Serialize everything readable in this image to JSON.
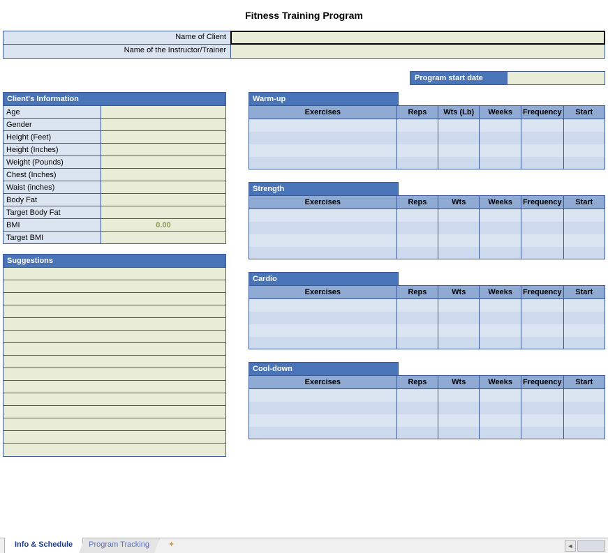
{
  "title": "Fitness Training Program",
  "header": {
    "client_label": "Name of Client",
    "trainer_label": "Name of the Instructor/Trainer",
    "client_value": "",
    "trainer_value": ""
  },
  "start_date": {
    "label": "Program start date",
    "value": ""
  },
  "client_info": {
    "header": "Client's Information",
    "rows": [
      {
        "label": "Age",
        "value": ""
      },
      {
        "label": "Gender",
        "value": ""
      },
      {
        "label": "Height (Feet)",
        "value": ""
      },
      {
        "label": "Height (Inches)",
        "value": ""
      },
      {
        "label": "Weight (Pounds)",
        "value": ""
      },
      {
        "label": "Chest (Inches)",
        "value": ""
      },
      {
        "label": "Waist (inches)",
        "value": ""
      },
      {
        "label": "Body Fat",
        "value": ""
      },
      {
        "label": "Target Body Fat",
        "value": ""
      },
      {
        "label": "BMI",
        "value": "0.00",
        "computed": true
      },
      {
        "label": "Target BMI",
        "value": ""
      }
    ]
  },
  "suggestions": {
    "header": "Suggestions",
    "row_count": 15
  },
  "exercise_sections": [
    {
      "title": "Warm-up",
      "cols": [
        "Exercises",
        "Reps",
        "Wts (Lb)",
        "Weeks",
        "Frequency",
        "Start"
      ],
      "row_count": 4
    },
    {
      "title": "Strength",
      "cols": [
        "Exercises",
        "Reps",
        "Wts",
        "Weeks",
        "Frequency",
        "Start"
      ],
      "row_count": 4
    },
    {
      "title": "Cardio",
      "cols": [
        "Exercises",
        "Reps",
        "Wts",
        "Weeks",
        "Frequency",
        "Start"
      ],
      "row_count": 4
    },
    {
      "title": "Cool-down",
      "cols": [
        "Exercises",
        "Reps",
        "Wts",
        "Weeks",
        "Frequency",
        "Start"
      ],
      "row_count": 4
    }
  ],
  "tabs": {
    "active": "Info & Schedule",
    "inactive": "Program Tracking"
  }
}
